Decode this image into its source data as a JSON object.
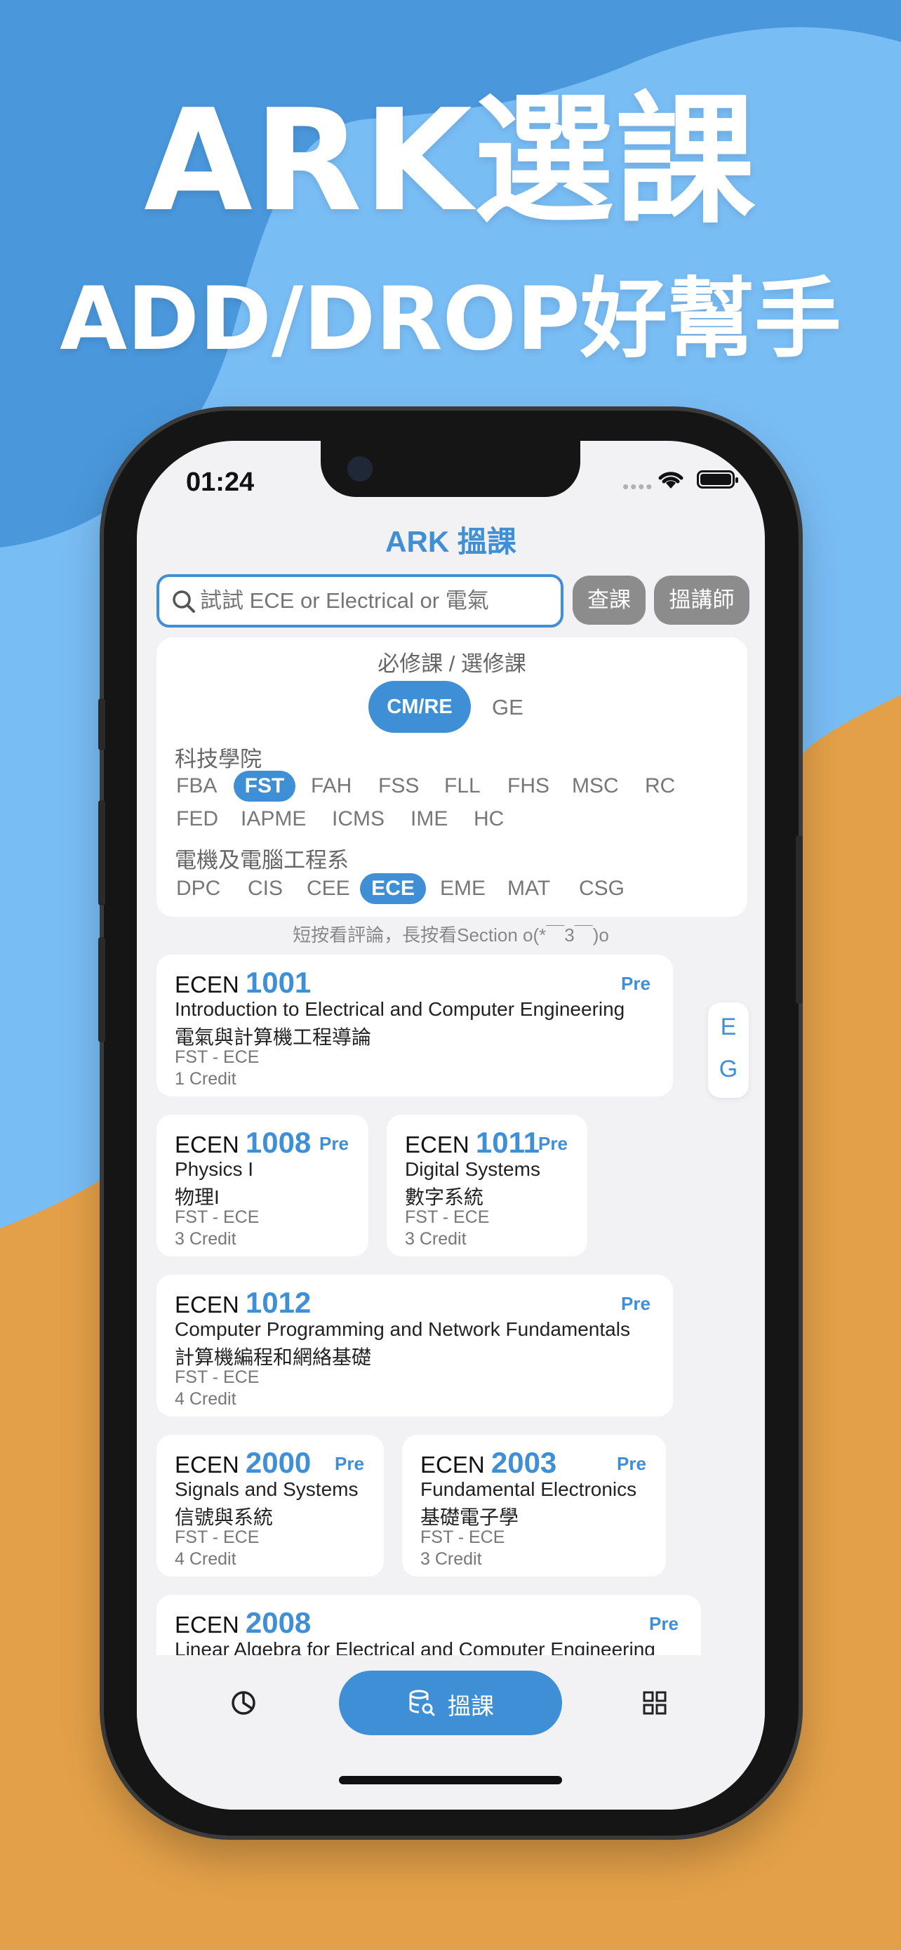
{
  "headline": {
    "line1": "ARK選課",
    "line2": "ADD/DROP好幫手"
  },
  "status": {
    "time": "01:24",
    "dots": "••••"
  },
  "app": {
    "title": "ARK 搵課"
  },
  "search": {
    "placeholder": "試試 ECE or Electrical or 電氣",
    "find_course": "查課",
    "find_teacher": "搵講師"
  },
  "filter": {
    "title": "必修課 / 選修課",
    "segments": [
      "CM/RE",
      "GE"
    ],
    "faculty_label": "科技學院",
    "faculties_row1": [
      "FBA",
      "FST",
      "FAH",
      "FSS",
      "FLL",
      "FHS",
      "MSC",
      "RC"
    ],
    "faculties_row2": [
      "FED",
      "IAPME",
      "ICMS",
      "IME",
      "HC"
    ],
    "dept_label": "電機及電腦工程系",
    "departments": [
      "DPC",
      "CIS",
      "CEE",
      "ECE",
      "EME",
      "MAT",
      "CSG"
    ]
  },
  "hint": "短按看評論，長按看Section o(*￣3￣)o",
  "courses": [
    {
      "prefix": "ECEN",
      "num": "1001",
      "pre": "Pre",
      "en": "Introduction to Electrical and Computer Engineering",
      "zh": "電氣與計算機工程導論",
      "dept": "FST - ECE",
      "credit": "1 Credit"
    },
    {
      "prefix": "ECEN",
      "num": "1008",
      "pre": "Pre",
      "en": "Physics I",
      "zh": "物理I",
      "dept": "FST - ECE",
      "credit": "3 Credit"
    },
    {
      "prefix": "ECEN",
      "num": "1011",
      "pre": "Pre",
      "en": "Digital Systems",
      "zh": "數字系統",
      "dept": "FST - ECE",
      "credit": "3 Credit"
    },
    {
      "prefix": "ECEN",
      "num": "1012",
      "pre": "Pre",
      "en": "Computer Programming and Network Fundamentals",
      "zh": "計算機編程和網絡基礎",
      "dept": "FST - ECE",
      "credit": "4 Credit"
    },
    {
      "prefix": "ECEN",
      "num": "2000",
      "pre": "Pre",
      "en": "Signals and Systems",
      "zh": "信號與系統",
      "dept": "FST - ECE",
      "credit": "4 Credit"
    },
    {
      "prefix": "ECEN",
      "num": "2003",
      "pre": "Pre",
      "en": "Fundamental Electronics",
      "zh": "基礎電子學",
      "dept": "FST - ECE",
      "credit": "3 Credit"
    },
    {
      "prefix": "ECEN",
      "num": "2008",
      "pre": "Pre",
      "en": "Linear Algebra for Electrical and Computer Engineering",
      "zh": "",
      "dept": "",
      "credit": ""
    }
  ],
  "index": [
    "E",
    "G"
  ],
  "tabbar": {
    "main_label": "搵課"
  },
  "colors": {
    "accent": "#3f8fd6",
    "bg_blue": "#79bdf5",
    "bg_orange": "#e3a048"
  },
  "icons": [
    "search-icon",
    "wifi-icon",
    "battery-icon",
    "pie-chart-icon",
    "database-search-icon",
    "grid-icon"
  ]
}
